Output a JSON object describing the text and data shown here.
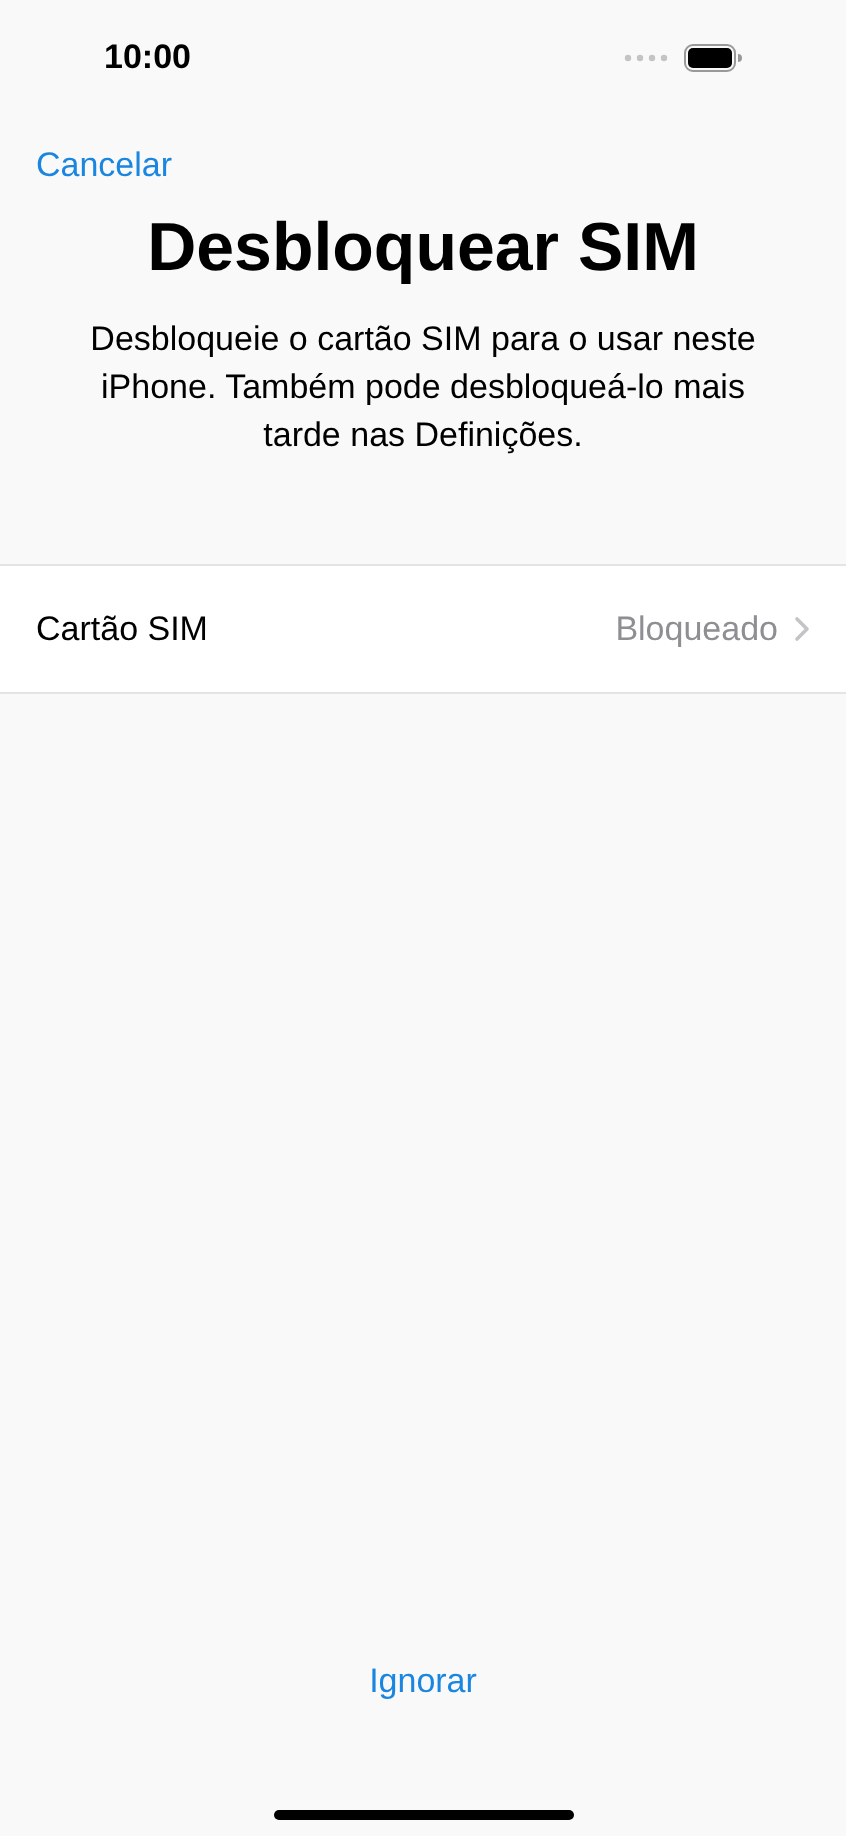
{
  "status_bar": {
    "time": "10:00"
  },
  "nav": {
    "cancel": "Cancelar"
  },
  "title": "Desbloquear SIM",
  "description": "Desbloqueie o cartão SIM para o usar neste iPhone. Também pode desbloqueá-lo mais tarde nas Definições.",
  "rows": [
    {
      "label": "Cartão SIM",
      "value": "Bloqueado"
    }
  ],
  "footer": {
    "skip": "Ignorar"
  }
}
